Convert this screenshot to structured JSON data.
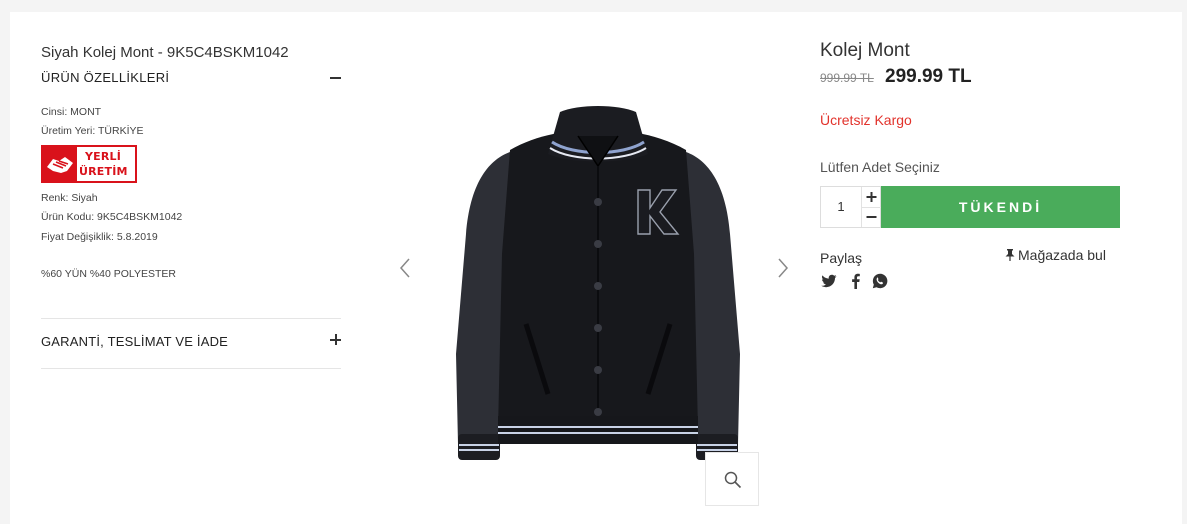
{
  "product": {
    "full_title": "Siyah Kolej Mont - 9K5C4BSKM1042",
    "name": "Kolej Mont",
    "old_price": "999.99 TL",
    "new_price": "299.99 TL",
    "shipping": "Ücretsiz Kargo"
  },
  "features": {
    "heading": "ÜRÜN ÖZELLİKLERİ",
    "type": "Cinsi: MONT",
    "origin": "Üretim Yeri: TÜRKİYE",
    "badge_line1": "YERLİ",
    "badge_line2": "ÜRETİM",
    "color": "Renk: Siyah",
    "code": "Ürün Kodu: 9K5C4BSKM1042",
    "price_change": "Fiyat Değişiklik: 5.8.2019",
    "material": "%60 YÜN %40 POLYESTER"
  },
  "accordion": {
    "warranty_label": "GARANTİ, TESLİMAT VE İADE"
  },
  "purchase": {
    "qty_label": "Lütfen Adet Seçiniz",
    "qty_value": "1",
    "qty_plus": "+",
    "qty_minus": "−",
    "sold_out_label": "TÜKENDİ",
    "sold_out_color": "#4aac5b"
  },
  "share": {
    "label": "Paylaş",
    "icons": [
      "twitter-icon",
      "facebook-icon",
      "whatsapp-icon"
    ],
    "store_label": "Mağazada bul"
  },
  "gallery": {
    "image_alt": "black varsity jacket with letter K",
    "icons": [
      "chevron-left-icon",
      "chevron-right-icon",
      "zoom-icon"
    ]
  },
  "colors": {
    "accent_red": "#e2332c",
    "badge_red": "#d9121b",
    "button_green": "#4aac5b"
  }
}
